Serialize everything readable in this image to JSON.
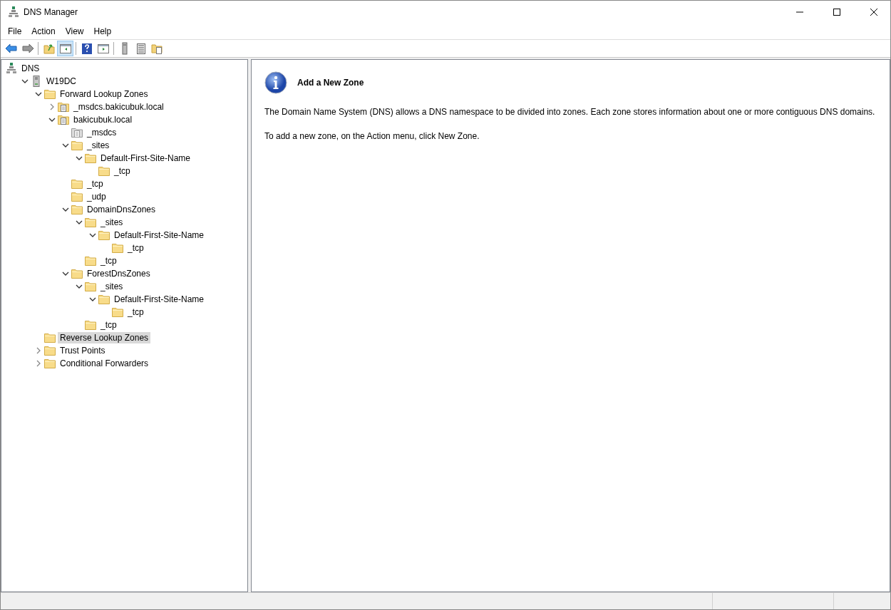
{
  "window": {
    "title": "DNS Manager"
  },
  "menu": [
    "File",
    "Action",
    "View",
    "Help"
  ],
  "toolbar_groups": [
    [
      {
        "kind": "back",
        "pressed": false
      },
      {
        "kind": "forward",
        "pressed": false
      }
    ],
    [
      {
        "kind": "up",
        "pressed": false
      },
      {
        "kind": "tree",
        "pressed": true
      }
    ],
    [
      {
        "kind": "help",
        "pressed": false
      },
      {
        "kind": "pane",
        "pressed": false
      }
    ],
    [
      {
        "kind": "server",
        "pressed": false
      },
      {
        "kind": "list",
        "pressed": false
      },
      {
        "kind": "zone",
        "pressed": false
      }
    ]
  ],
  "tree": [
    {
      "label": "DNS",
      "kind": "dns",
      "selected": false,
      "children": [
        {
          "label": "W19DC",
          "kind": "server",
          "expanded": true,
          "selected": false,
          "children": [
            {
              "label": "Forward Lookup Zones",
              "kind": "folder",
              "expanded": true,
              "selected": false,
              "children": [
                {
                  "label": "_msdcs.bakicubuk.local",
                  "kind": "zone",
                  "expanded": false,
                  "selected": false
                },
                {
                  "label": "bakicubuk.local",
                  "kind": "zone",
                  "expanded": true,
                  "selected": false,
                  "children": [
                    {
                      "label": "_msdcs",
                      "kind": "delegation",
                      "selected": false
                    },
                    {
                      "label": "_sites",
                      "kind": "folder",
                      "expanded": true,
                      "selected": false,
                      "children": [
                        {
                          "label": "Default-First-Site-Name",
                          "kind": "folder",
                          "expanded": true,
                          "selected": false,
                          "children": [
                            {
                              "label": "_tcp",
                              "kind": "folder",
                              "selected": false
                            }
                          ]
                        }
                      ]
                    },
                    {
                      "label": "_tcp",
                      "kind": "folder",
                      "selected": false
                    },
                    {
                      "label": "_udp",
                      "kind": "folder",
                      "selected": false
                    },
                    {
                      "label": "DomainDnsZones",
                      "kind": "folder",
                      "expanded": true,
                      "selected": false,
                      "children": [
                        {
                          "label": "_sites",
                          "kind": "folder",
                          "expanded": true,
                          "selected": false,
                          "children": [
                            {
                              "label": "Default-First-Site-Name",
                              "kind": "folder",
                              "expanded": true,
                              "selected": false,
                              "children": [
                                {
                                  "label": "_tcp",
                                  "kind": "folder",
                                  "selected": false
                                }
                              ]
                            }
                          ]
                        },
                        {
                          "label": "_tcp",
                          "kind": "folder",
                          "selected": false
                        }
                      ]
                    },
                    {
                      "label": "ForestDnsZones",
                      "kind": "folder",
                      "expanded": true,
                      "selected": false,
                      "children": [
                        {
                          "label": "_sites",
                          "kind": "folder",
                          "expanded": true,
                          "selected": false,
                          "children": [
                            {
                              "label": "Default-First-Site-Name",
                              "kind": "folder",
                              "expanded": true,
                              "selected": false,
                              "children": [
                                {
                                  "label": "_tcp",
                                  "kind": "folder",
                                  "selected": false
                                }
                              ]
                            }
                          ]
                        },
                        {
                          "label": "_tcp",
                          "kind": "folder",
                          "selected": false
                        }
                      ]
                    }
                  ]
                }
              ]
            },
            {
              "label": "Reverse Lookup Zones",
              "kind": "folder",
              "selected": true
            },
            {
              "label": "Trust Points",
              "kind": "folder",
              "expanded": false,
              "selected": false
            },
            {
              "label": "Conditional Forwarders",
              "kind": "folder",
              "expanded": false,
              "selected": false
            }
          ]
        }
      ]
    }
  ],
  "info": {
    "heading": "Add a New Zone",
    "paragraphs": [
      "The Domain Name System (DNS) allows a DNS namespace to be divided into zones. Each zone stores information about one or more contiguous DNS domains.",
      "To add a new zone, on the Action menu, click New Zone."
    ]
  }
}
